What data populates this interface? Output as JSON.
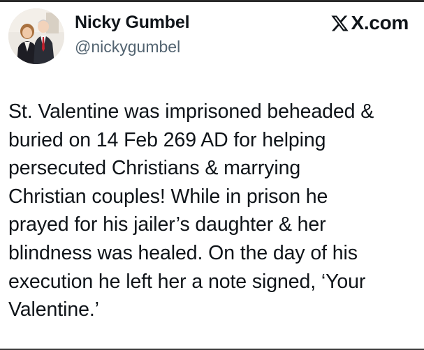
{
  "author": {
    "display_name": "Nicky Gumbel",
    "handle": "@nickygumbel",
    "avatar_icon": "profile-photo"
  },
  "brand": {
    "icon": "x-logo-icon",
    "label": "X.com"
  },
  "tweet": {
    "lines": [
      "St. Valentine was imprisoned beheaded &",
      "buried on 14 Feb 269 AD for helping",
      "persecuted Christians & marrying",
      "Christian couples! While in prison he",
      "prayed for his jailer’s daughter & her",
      "blindness was healed. On the day of his",
      "execution he left her a note signed, ‘Your",
      "Valentine.’"
    ]
  },
  "colors": {
    "text_primary": "#0f1419",
    "text_secondary": "#536471",
    "background": "#ffffff"
  }
}
